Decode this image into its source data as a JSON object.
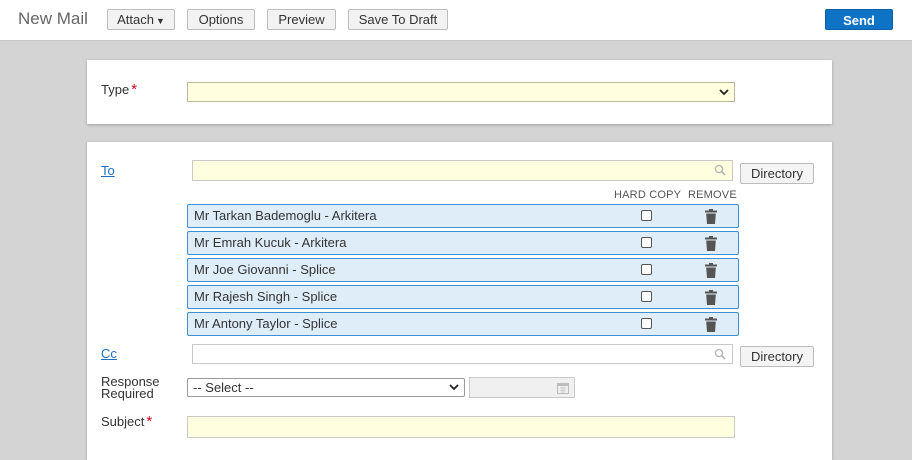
{
  "header": {
    "title": "New Mail",
    "buttons": {
      "attach": "Attach",
      "options": "Options",
      "preview": "Preview",
      "save_draft": "Save To Draft",
      "send": "Send"
    }
  },
  "type_panel": {
    "label": "Type",
    "value": ""
  },
  "recipients_panel": {
    "to_label": "To",
    "to_value": "",
    "directory_label": "Directory",
    "col_hard_copy": "HARD COPY",
    "col_remove": "REMOVE",
    "recipients": [
      {
        "name": "Mr Tarkan Bademoglu - Arkitera",
        "hard_copy": false
      },
      {
        "name": "Mr Emrah Kucuk - Arkitera",
        "hard_copy": false
      },
      {
        "name": "Mr Joe Giovanni - Splice",
        "hard_copy": false
      },
      {
        "name": "Mr Rajesh Singh - Splice",
        "hard_copy": false
      },
      {
        "name": "Mr Antony Taylor - Splice",
        "hard_copy": false
      }
    ],
    "cc_label": "Cc",
    "cc_value": "",
    "response_label_line1": "Response",
    "response_label_line2": "Required",
    "response_select": "-- Select --",
    "response_date": "",
    "subject_label": "Subject",
    "subject_value": ""
  },
  "colors": {
    "accent": "#0f73c5",
    "required": "#d9001b",
    "link": "#1a6fc2",
    "field_highlight": "#ffffe0",
    "recipient_bg": "#dfedf9"
  }
}
